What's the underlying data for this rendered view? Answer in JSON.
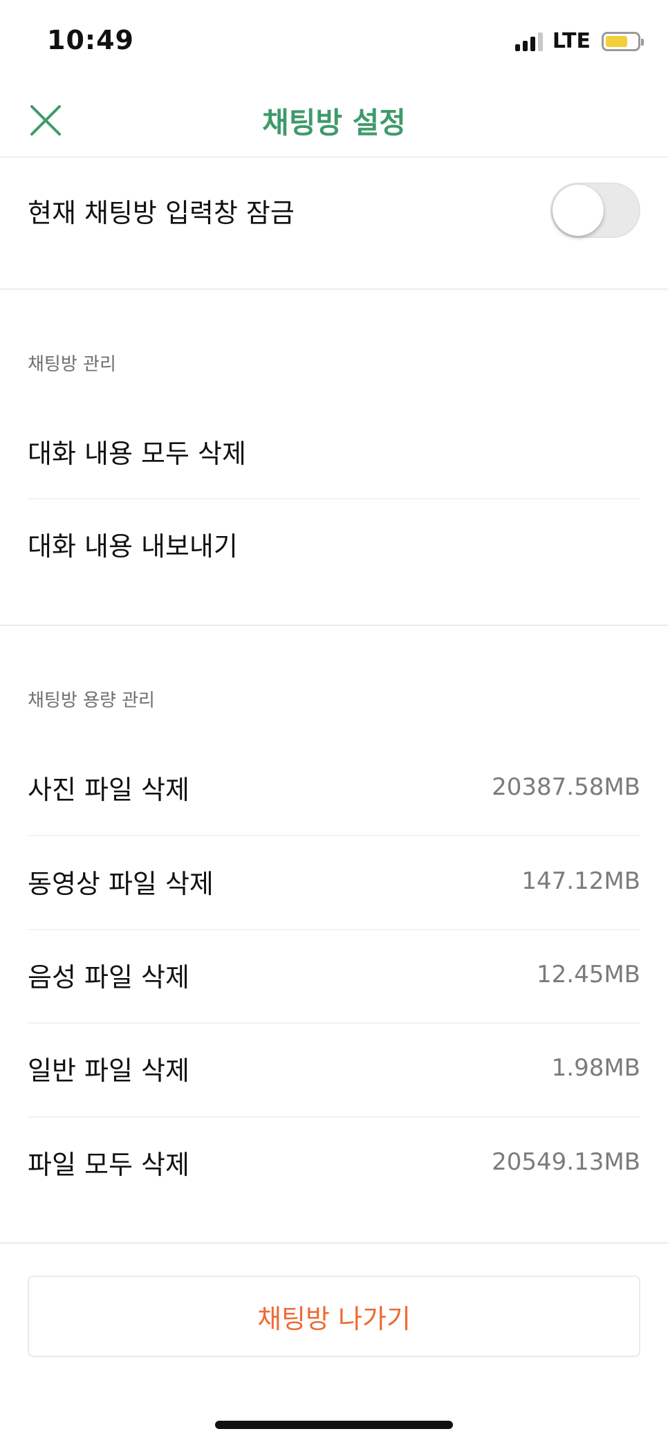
{
  "status_bar": {
    "time": "10:49",
    "network": "LTE",
    "battery_level": 0.7,
    "battery_color": "#f4cf3c"
  },
  "header": {
    "title": "채팅방 설정",
    "close_icon": "close-icon",
    "accent_color": "#3f9a6b"
  },
  "lock_input": {
    "label": "현재 채팅방 입력창 잠금",
    "enabled": false
  },
  "chat_management": {
    "title": "채팅방 관리",
    "items": [
      {
        "label": "대화 내용 모두 삭제"
      },
      {
        "label": "대화 내용 내보내기"
      }
    ]
  },
  "storage_management": {
    "title": "채팅방 용량 관리",
    "items": [
      {
        "label": "사진 파일 삭제",
        "size": "20387.58MB"
      },
      {
        "label": "동영상 파일 삭제",
        "size": "147.12MB"
      },
      {
        "label": "음성 파일 삭제",
        "size": "12.45MB"
      },
      {
        "label": "일반 파일 삭제",
        "size": "1.98MB"
      },
      {
        "label": "파일 모두 삭제",
        "size": "20549.13MB"
      }
    ]
  },
  "leave_button": {
    "label": "채팅방 나가기",
    "color": "#ee6a35"
  }
}
